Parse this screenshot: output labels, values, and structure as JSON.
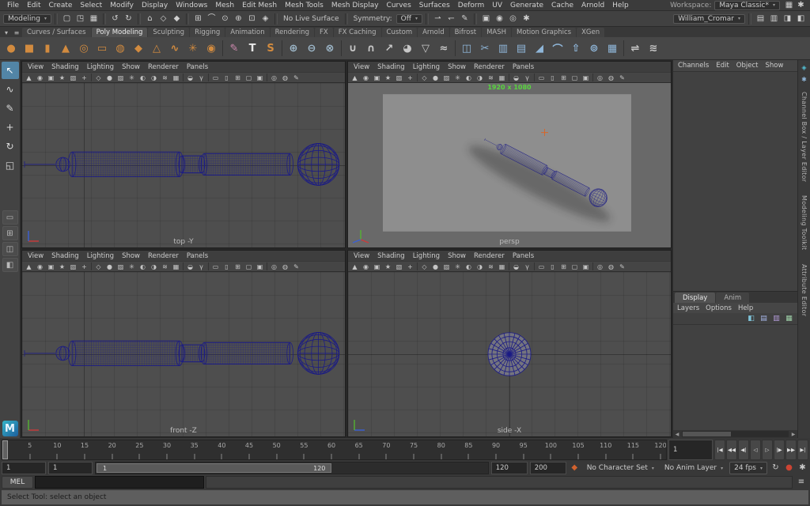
{
  "menubar": {
    "items": [
      "File",
      "Edit",
      "Create",
      "Select",
      "Modify",
      "Display",
      "Windows",
      "Mesh",
      "Edit Mesh",
      "Mesh Tools",
      "Mesh Display",
      "Curves",
      "Surfaces",
      "Deform",
      "UV",
      "Generate",
      "Cache",
      "Arnold",
      "Help"
    ],
    "workspace_label": "Workspace:",
    "workspace_value": "Maya Classic*",
    "right_icons": [
      {
        "n": "workspace-grid-icon",
        "g": "▦"
      },
      {
        "n": "workspace-options-icon",
        "g": "✱"
      }
    ]
  },
  "statusline": {
    "segments": [
      {
        "type": "dropdown",
        "name": "menu-set-selector",
        "value": "Modeling"
      },
      {
        "type": "sep"
      },
      {
        "type": "icons",
        "items": [
          {
            "n": "new-scene-icon",
            "g": "▢"
          },
          {
            "n": "open-scene-icon",
            "g": "◳"
          },
          {
            "n": "save-scene-icon",
            "g": "▦"
          }
        ]
      },
      {
        "type": "sep"
      },
      {
        "type": "icons",
        "items": [
          {
            "n": "undo-icon",
            "g": "↺"
          },
          {
            "n": "redo-icon",
            "g": "↻"
          }
        ]
      },
      {
        "type": "sep"
      },
      {
        "type": "icons",
        "items": [
          {
            "n": "select-hierarchy-icon",
            "g": "⌂"
          },
          {
            "n": "select-object-icon",
            "g": "◇"
          },
          {
            "n": "select-component-icon",
            "g": "◆"
          }
        ]
      },
      {
        "type": "sep"
      },
      {
        "type": "icons",
        "items": [
          {
            "n": "snap-to-grid-icon",
            "g": "⊞"
          },
          {
            "n": "snap-to-curve-icon",
            "g": "⌒"
          },
          {
            "n": "snap-to-point-icon",
            "g": "⊙"
          },
          {
            "n": "snap-to-projected-center-icon",
            "g": "⊕"
          },
          {
            "n": "snap-to-view-plane-icon",
            "g": "⊡"
          },
          {
            "n": "make-live-icon",
            "g": "◈"
          }
        ]
      },
      {
        "type": "sep"
      },
      {
        "type": "label",
        "name": "live-surface-label",
        "value": "No Live Surface"
      },
      {
        "type": "sep"
      },
      {
        "type": "label",
        "name": "symmetry-label",
        "value": "Symmetry:"
      },
      {
        "type": "dropdown",
        "name": "symmetry-selector",
        "value": "Off"
      },
      {
        "type": "sep"
      },
      {
        "type": "icons",
        "items": [
          {
            "n": "input-connections-icon",
            "g": "⇀"
          },
          {
            "n": "output-connections-icon",
            "g": "↽"
          },
          {
            "n": "construction-history-icon",
            "g": "✎"
          }
        ]
      },
      {
        "type": "sep"
      },
      {
        "type": "icons",
        "items": [
          {
            "n": "open-render-view-icon",
            "g": "▣"
          },
          {
            "n": "render-current-frame-icon",
            "g": "◉"
          },
          {
            "n": "ipr-render-icon",
            "g": "◎"
          },
          {
            "n": "render-settings-icon",
            "g": "✱"
          }
        ]
      },
      {
        "type": "spacer"
      },
      {
        "type": "dropdown",
        "name": "user-preset-selector",
        "value": "William_Cromar"
      },
      {
        "type": "sep"
      },
      {
        "type": "icons",
        "items": [
          {
            "n": "toggle-modeling-toolkit-icon",
            "g": "▤"
          },
          {
            "n": "toggle-channel-box-icon",
            "g": "▥"
          },
          {
            "n": "toggle-attribute-editor-icon",
            "g": "◨"
          },
          {
            "n": "toggle-tool-settings-icon",
            "g": "◧"
          }
        ]
      }
    ]
  },
  "shelf": {
    "menu_icons": [
      {
        "n": "shelf-menu-icon",
        "g": "▾"
      },
      {
        "n": "shelf-config-icon",
        "g": "≡"
      }
    ],
    "tabs": [
      "Curves / Surfaces",
      "Poly Modeling",
      "Sculpting",
      "Rigging",
      "Animation",
      "Rendering",
      "FX",
      "FX Caching",
      "Custom",
      "Arnold",
      "Bifrost",
      "MASH",
      "Motion Graphics",
      "XGen"
    ],
    "active_tab": "Poly Modeling",
    "items": [
      {
        "n": "shelf-poly-sphere",
        "g": "●",
        "c": "#d28b3f"
      },
      {
        "n": "shelf-poly-cube",
        "g": "■",
        "c": "#d28b3f"
      },
      {
        "n": "shelf-poly-cylinder",
        "g": "▮",
        "c": "#d28b3f"
      },
      {
        "n": "shelf-poly-cone",
        "g": "▲",
        "c": "#d28b3f"
      },
      {
        "n": "shelf-poly-torus",
        "g": "◎",
        "c": "#d28b3f"
      },
      {
        "n": "shelf-poly-plane",
        "g": "▭",
        "c": "#d28b3f"
      },
      {
        "n": "shelf-poly-disc",
        "g": "◍",
        "c": "#d28b3f"
      },
      {
        "n": "shelf-platonic-solid",
        "g": "◆",
        "c": "#d28b3f"
      },
      {
        "n": "shelf-poly-pyramid",
        "g": "△",
        "c": "#d28b3f"
      },
      {
        "n": "shelf-poly-helix",
        "g": "∿",
        "c": "#d28b3f"
      },
      {
        "n": "shelf-poly-gear",
        "g": "✳",
        "c": "#d28b3f"
      },
      {
        "n": "shelf-soccer-ball",
        "g": "◉",
        "c": "#d28b3f"
      },
      {
        "sep": true
      },
      {
        "n": "shelf-sculpt-tool",
        "g": "✎",
        "c": "#cf8ab0"
      },
      {
        "n": "shelf-3d-type",
        "g": "T",
        "c": "#e8e8e8"
      },
      {
        "n": "shelf-svg-tool",
        "g": "S",
        "c": "#d28b3f"
      },
      {
        "sep": true
      },
      {
        "n": "shelf-boolean-union",
        "g": "⊕",
        "c": "#9fb9cb"
      },
      {
        "n": "shelf-boolean-difference",
        "g": "⊖",
        "c": "#9fb9cb"
      },
      {
        "n": "shelf-boolean-intersection",
        "g": "⊗",
        "c": "#9fb9cb"
      },
      {
        "sep": true
      },
      {
        "n": "shelf-combine",
        "g": "∪",
        "c": "#c7c7c7"
      },
      {
        "n": "shelf-separate",
        "g": "∩",
        "c": "#c7c7c7"
      },
      {
        "n": "shelf-extract",
        "g": "↗",
        "c": "#c7c7c7"
      },
      {
        "n": "shelf-fill-hole",
        "g": "◕",
        "c": "#c7c7c7"
      },
      {
        "n": "shelf-reduce",
        "g": "▽",
        "c": "#c7c7c7"
      },
      {
        "n": "shelf-smooth",
        "g": "≈",
        "c": "#c7c7c7"
      },
      {
        "sep": true
      },
      {
        "n": "shelf-mirror",
        "g": "◫",
        "c": "#8fb6d9"
      },
      {
        "n": "shelf-multi-cut",
        "g": "✂",
        "c": "#8fb6d9"
      },
      {
        "n": "shelf-insert-edge-loop",
        "g": "▥",
        "c": "#8fb6d9"
      },
      {
        "n": "shelf-offset-edge-loop",
        "g": "▤",
        "c": "#8fb6d9"
      },
      {
        "n": "shelf-bevel",
        "g": "◢",
        "c": "#8fb6d9"
      },
      {
        "n": "shelf-bridge",
        "g": "⌒",
        "c": "#8fb6d9"
      },
      {
        "n": "shelf-extrude",
        "g": "⇧",
        "c": "#8fb6d9"
      },
      {
        "n": "shelf-target-weld",
        "g": "⊚",
        "c": "#8fb6d9"
      },
      {
        "n": "shelf-quad-draw",
        "g": "▦",
        "c": "#8fb6d9"
      },
      {
        "sep": true
      },
      {
        "n": "shelf-symmetrize",
        "g": "⇌",
        "c": "#c7c7c7"
      },
      {
        "n": "shelf-average-vertices",
        "g": "≋",
        "c": "#c7c7c7"
      }
    ]
  },
  "toolbox": {
    "tools": [
      {
        "n": "select-tool",
        "g": "↖",
        "active": true
      },
      {
        "n": "lasso-select-tool",
        "g": "∿"
      },
      {
        "n": "paint-select-tool",
        "g": "✎"
      },
      {
        "n": "move-tool",
        "g": "+"
      },
      {
        "n": "rotate-tool",
        "g": "↻"
      },
      {
        "n": "scale-tool",
        "g": "◱"
      }
    ],
    "layouts": [
      {
        "n": "layout-single-pane-button",
        "g": "▭"
      },
      {
        "n": "layout-four-pane-button",
        "g": "⊞"
      },
      {
        "n": "layout-two-pane-button",
        "g": "◫"
      },
      {
        "n": "layout-outliner-persp-button",
        "g": "◧"
      }
    ],
    "logo": "M"
  },
  "viewport_menus": [
    "View",
    "Shading",
    "Lighting",
    "Show",
    "Renderer",
    "Panels"
  ],
  "viewport_toolbar_icons": [
    {
      "n": "select-camera-icon",
      "g": "▲"
    },
    {
      "n": "lock-camera-icon",
      "g": "◉"
    },
    {
      "n": "camera-attributes-icon",
      "g": "▣"
    },
    {
      "n": "bookmarks-icon",
      "g": "★"
    },
    {
      "n": "image-plane-icon",
      "g": "▧"
    },
    {
      "n": "2d-pan-zoom-icon",
      "g": "+"
    },
    {
      "sep": true
    },
    {
      "n": "wireframe-icon",
      "g": "◇"
    },
    {
      "n": "smooth-shade-icon",
      "g": "●"
    },
    {
      "n": "textured-icon",
      "g": "▨"
    },
    {
      "n": "use-all-lights-icon",
      "g": "✳"
    },
    {
      "n": "shadows-icon",
      "g": "◐"
    },
    {
      "n": "screen-space-ao-icon",
      "g": "◑"
    },
    {
      "n": "motion-blur-icon",
      "g": "≋"
    },
    {
      "n": "anti-aliasing-icon",
      "g": "▦"
    },
    {
      "sep": true
    },
    {
      "n": "exposure-icon",
      "g": "◒"
    },
    {
      "n": "gamma-icon",
      "g": "γ"
    },
    {
      "sep": true
    },
    {
      "n": "resolution-gate-icon",
      "g": "▭"
    },
    {
      "n": "film-gate-icon",
      "g": "▯"
    },
    {
      "n": "field-chart-icon",
      "g": "⊞"
    },
    {
      "n": "safe-action-icon",
      "g": "▢"
    },
    {
      "n": "safe-title-icon",
      "g": "▣"
    },
    {
      "sep": true
    },
    {
      "n": "isolate-select-icon",
      "g": "◎"
    },
    {
      "n": "x-ray-icon",
      "g": "◍"
    },
    {
      "n": "grease-pencil-icon",
      "g": "✎"
    }
  ],
  "viewports": [
    {
      "id": "top",
      "label": "top -Y",
      "type": "ortho-h"
    },
    {
      "id": "persp",
      "label": "persp",
      "type": "persp",
      "resolution_text": "1920 x 1080"
    },
    {
      "id": "front",
      "label": "front -Z",
      "type": "ortho-h"
    },
    {
      "id": "side",
      "label": "side -X",
      "type": "ortho-sphere"
    }
  ],
  "channel_box": {
    "menus": [
      "Channels",
      "Edit",
      "Object",
      "Show"
    ]
  },
  "layer_editor": {
    "tabs": [
      "Display",
      "Anim"
    ],
    "active_tab": "Display",
    "menus": [
      "Layers",
      "Options",
      "Help"
    ],
    "icons": [
      {
        "n": "move-selected-to-layer-icon",
        "g": "◧",
        "c": "#7fc4d9"
      },
      {
        "n": "new-empty-layer-icon",
        "g": "▤",
        "c": "#a6b6e8"
      },
      {
        "n": "new-layer-from-selected-icon",
        "g": "▥",
        "c": "#b79ede"
      },
      {
        "n": "layer-options-icon",
        "g": "▦",
        "c": "#9fd0a8"
      }
    ],
    "scrollbar": {
      "left": "◀",
      "right": "▶"
    }
  },
  "side_tabs": {
    "icons": [
      {
        "n": "sidebar-pin-icon",
        "g": "◈",
        "c": "#54c3d8"
      },
      {
        "n": "sidebar-gear-icon",
        "g": "✱",
        "c": "#8fb6d9"
      }
    ],
    "labels": [
      "Channel Box / Layer Editor",
      "Modeling Toolkit",
      "Attribute Editor"
    ]
  },
  "timeline": {
    "tick_labels": [
      "5",
      "10",
      "15",
      "20",
      "25",
      "30",
      "35",
      "40",
      "45",
      "50",
      "55",
      "60",
      "65",
      "70",
      "75",
      "80",
      "85",
      "90",
      "95",
      "100",
      "105",
      "110",
      "115",
      "120"
    ],
    "frame_max": 121,
    "current_frame": "1",
    "transport": [
      {
        "n": "go-to-start-button",
        "g": "|◀"
      },
      {
        "n": "step-back-key-button",
        "g": "◀◀"
      },
      {
        "n": "step-back-frame-button",
        "g": "◀|"
      },
      {
        "n": "play-backwards-button",
        "g": "◁"
      },
      {
        "n": "play-forwards-button",
        "g": "▷"
      },
      {
        "n": "step-forward-frame-button",
        "g": "|▶"
      },
      {
        "n": "step-forward-key-button",
        "g": "▶▶"
      },
      {
        "n": "go-to-end-button",
        "g": "▶|"
      }
    ],
    "range": {
      "anim_start": "1",
      "play_start": "1",
      "bar_start_label": "1",
      "bar_end_label": "120",
      "play_end": "120",
      "anim_end": "200",
      "bar_fraction": 0.6
    },
    "character_set": "No Character Set",
    "anim_layer": "No Anim Layer",
    "fps": "24 fps",
    "range_icons_left": [
      {
        "n": "character-set-key-icon",
        "g": "◆",
        "c": "#d2622e"
      }
    ],
    "range_icons_right": [
      {
        "n": "playback-loop-icon",
        "g": "↻",
        "c": "#c9c9c9"
      },
      {
        "n": "auto-keyframe-icon",
        "g": "●",
        "c": "#cc4433"
      },
      {
        "n": "animation-preferences-icon",
        "g": "✱",
        "c": "#c9c9c9"
      }
    ]
  },
  "command_line": {
    "label": "MEL",
    "icon_glyph": "≡"
  },
  "help_line": {
    "text": "Select Tool: select an object"
  }
}
